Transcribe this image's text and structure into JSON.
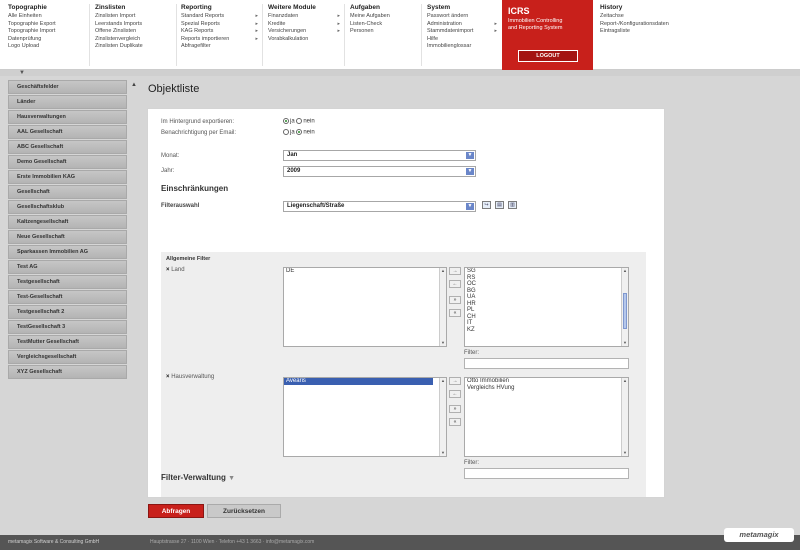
{
  "nav": {
    "topographie": {
      "title": "Topographie",
      "items": [
        "Alle Einheiten",
        "Topographie Export",
        "Topographie Import",
        "Datenprüfung",
        "Logo Upload"
      ]
    },
    "zinslisten": {
      "title": "Zinslisten",
      "items": [
        "Zinslisten Import",
        "Leerstands Imports",
        "Offene Zinslisten",
        "Zinslistenvergleich",
        "Zinslisten Duplikate"
      ]
    },
    "reporting": {
      "title": "Reporting",
      "items": [
        "Standard Reports",
        "Spezial Reports",
        "KAG Reports",
        "Reports importieren",
        "Abfragefilter"
      ]
    },
    "weitere": {
      "title": "Weitere Module",
      "items": [
        "Finanzdaten",
        "Kredite",
        "Versicherungen",
        "Vorabkalkulation"
      ]
    },
    "aufgaben": {
      "title": "Aufgaben",
      "items": [
        "Meine Aufgaben",
        "Listen-Check",
        "Personen"
      ]
    },
    "system": {
      "title": "System",
      "items": [
        "Passwort ändern",
        "Administration",
        "Stammdatenimport",
        "Hilfe",
        "Immobilienglossar"
      ]
    },
    "history": {
      "title": "History",
      "items": [
        "Zeitachse",
        "Report-/Konfigurationsdaten",
        "Eintragsliste"
      ]
    }
  },
  "brand": {
    "name": "ICRS",
    "subtitle_line1": "Immobilien Controlling",
    "subtitle_line2": "and Reporting System",
    "logout": "LOGOUT",
    "color": "#c8201b"
  },
  "sidebar": {
    "items": [
      "Geschäftsfelder",
      "Länder",
      "Hausverwaltungen",
      "AAL Gesellschaft",
      "ABC Gesellschaft",
      "Demo Gesellschaft",
      "Erste Immobilien KAG",
      "Gesellschaft",
      "Gesellschaftsklub",
      "Kaltzengesellschaft",
      "Neue Gesellschaft",
      "Sparkassen Immobilien AG",
      "Test AG",
      "Testgesellschaft",
      "Test-Gesellschaft",
      "Testgesellschaft 2",
      "TestGesellschaft 3",
      "TestMutter Gesellschaft",
      "Vergleichsgesellschaft",
      "XYZ Gesellschaft"
    ]
  },
  "main": {
    "title": "Objektliste",
    "bg_export_label": "Im Hintergrund exportieren:",
    "notify_label": "Benachrichtigung per Email:",
    "ja": "ja",
    "nein": "nein",
    "monat_label": "Monat:",
    "monat_value": "Jan",
    "jahr_label": "Jahr:",
    "jahr_value": "2009",
    "einschraenkungen": "Einschränkungen",
    "filterauswahl_label": "Filterauswahl",
    "filterauswahl_value": "Liegenschaft/Straße",
    "allgemeine_filter": "Allgemeine Filter",
    "land_label": "Land",
    "land_available": [
      "DE"
    ],
    "land_selected": [
      "SG",
      "RS",
      "OC",
      "BG",
      "UA",
      "HR",
      "PL",
      "CH",
      "IT",
      "KZ"
    ],
    "filter_label": "Filter:",
    "hv_label": "Hausverwaltung",
    "hv_available": [
      "Avearis"
    ],
    "hv_selected": [
      "Otto Immobilien",
      "Vergleichs HVung"
    ],
    "filter_verwaltung": "Filter-Verwaltung"
  },
  "buttons": {
    "abfragen": "Abfragen",
    "zuruecksetzen": "Zurücksetzen"
  },
  "footer": {
    "company": "metamagix Software & Consulting GmbH",
    "address": "Hauptstrasse 27 · 1100 Wien · Telefon +43 1 3663 · info@metamagix.com",
    "logo": "metamagix"
  }
}
